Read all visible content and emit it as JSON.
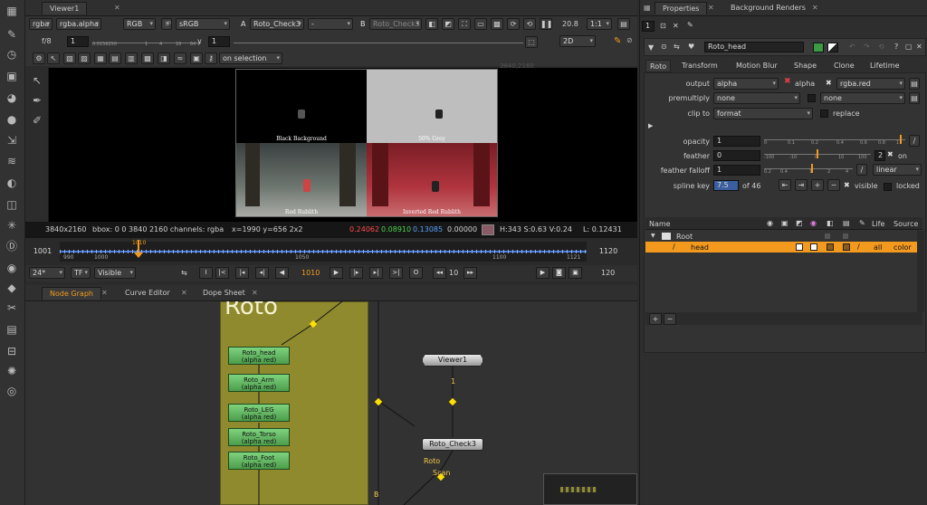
{
  "viewer_tab": "Viewer1",
  "viewer_controls": {
    "channels": "rgba",
    "alpha_channel": "rgba.alpha",
    "colorspace": "RGB",
    "lut": "sRGB",
    "input_a_label": "A",
    "input_a": "Roto_Check3",
    "input_a_op": "-",
    "input_b_label": "B",
    "input_b": "Roto_Check3",
    "zoom": "20.8",
    "ratio": "1:1",
    "fstop": "f/8",
    "gain_val": "1",
    "gain_ticks": [
      "1",
      "0.0156250",
      "1",
      "4",
      "16",
      "64"
    ],
    "y_label": "y",
    "gamma_val": "1",
    "view_mode": "2D",
    "on_selection": "on selection"
  },
  "viewer_image": {
    "resolution_label": "3840,2160",
    "quadrants": [
      "Black Background",
      "50% Grey",
      "Red Rublith",
      "Inverted Red Rublith"
    ]
  },
  "info_bar": {
    "format": "3840x2160",
    "bbox": "bbox: 0 0 3840 2160 channels: rgba",
    "coords": "x=1990 y=656 2x2",
    "r": "0.24062",
    "g": "0.08910",
    "b": "0.13085",
    "a": "0.00000",
    "swatch": "#8a5a66",
    "hsv": "H:343 S:0.63 V:0.24",
    "luma": "L: 0.12431"
  },
  "timeline": {
    "start": "1001",
    "end": "1120",
    "current": "1010",
    "ticks": [
      "990",
      "1000",
      "1050",
      "1100",
      "1121"
    ],
    "fps": "24*",
    "tf": "TF",
    "visible": "Visible",
    "frame_display": "1010",
    "step": "10",
    "end_frame": "120"
  },
  "panel_tabs": [
    "Node Graph",
    "Curve Editor",
    "Dope Sheet"
  ],
  "node_graph": {
    "backdrop_label": "Roto",
    "roto_nodes": [
      {
        "name": "Roto_head",
        "sub": "(alpha red)"
      },
      {
        "name": "Roto_Arm",
        "sub": "(alpha red)"
      },
      {
        "name": "Roto_LEG",
        "sub": "(alpha red)"
      },
      {
        "name": "Roto_Torso",
        "sub": "(alpha red)"
      },
      {
        "name": "Roto_Foot",
        "sub": "(alpha red)"
      }
    ],
    "viewer_node": "Viewer1",
    "viewer_input": "1",
    "check_node": "Roto_Check3",
    "edge_labels": [
      "Roto",
      "Scan",
      "B"
    ]
  },
  "properties": {
    "tabs": [
      "Properties",
      "Background Renders"
    ],
    "stack_count": "1",
    "node_name": "Roto_head",
    "node_tabs": [
      "Roto",
      "Transform",
      "Motion Blur",
      "Shape",
      "Clone",
      "Lifetime"
    ],
    "output_label": "output",
    "output_value": "alpha",
    "output_alpha": "alpha",
    "output_ch2": "rgba.red",
    "premultiply_label": "premultiply",
    "premultiply_value": "none",
    "premultiply_value2": "none",
    "clipto_label": "clip to",
    "clipto_value": "format",
    "replace_label": "replace",
    "opacity_label": "opacity",
    "opacity_value": "1",
    "opacity_ticks": [
      "0",
      "0.1",
      "0.2",
      "0.4",
      "0.6",
      "0.8",
      "1"
    ],
    "feather_label": "feather",
    "feather_value": "0",
    "feather_ticks": [
      "-100",
      "-10",
      "0",
      "10",
      "100"
    ],
    "feather_extra": "2",
    "feather_on": "on",
    "falloff_label": "feather falloff",
    "falloff_value": "1",
    "falloff_ticks": [
      "0.2",
      "0.4",
      "1",
      "2",
      "4"
    ],
    "falloff_type": "linear",
    "splinekey_label": "spline key",
    "splinekey_value": "7.5",
    "splinekey_of": "of 46",
    "visible_label": "visible",
    "locked_label": "locked",
    "list_columns": [
      "Name",
      "Life",
      "Source"
    ],
    "list_rows": [
      {
        "name": "Root",
        "life": "",
        "source": ""
      },
      {
        "name": "head",
        "life": "all",
        "source": "color"
      }
    ],
    "highlight_color": "#f39a1e"
  }
}
